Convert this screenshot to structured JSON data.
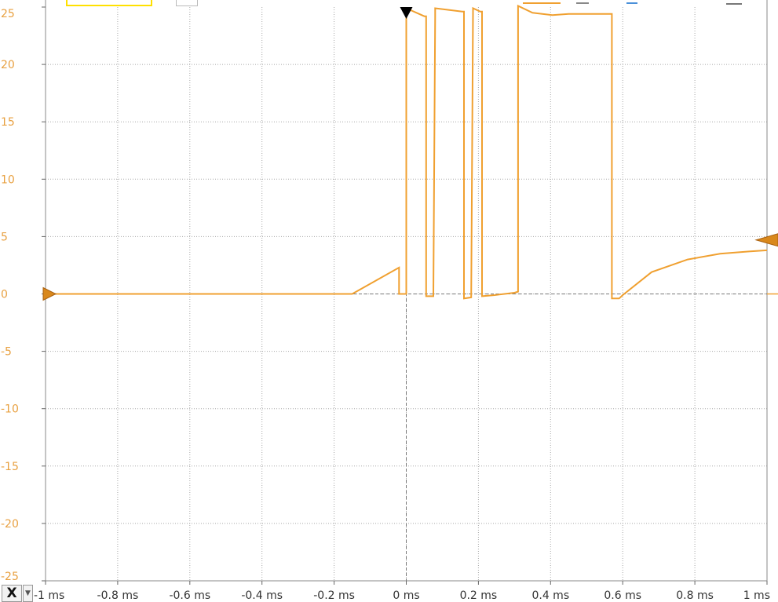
{
  "colors": {
    "trace": "#f0a030",
    "trace_dark": "#d9881c",
    "axis_label": "#e8a040",
    "grid": "#a8a8a8",
    "zero_line": "#777777",
    "trigger_marker": "#000000",
    "background": "#ffffff"
  },
  "x_axis_control": {
    "label": "X",
    "dropdown_icon": "caret-down-icon"
  },
  "toolbar_icons": [
    "channel-color-swatch-icon",
    "toolbar-button-icon",
    "cursor-icon",
    "math-icon",
    "zoom-icon",
    "settings-icon"
  ],
  "chart_data": {
    "type": "line",
    "title": "",
    "xlabel": "",
    "ylabel": "",
    "xlim": [
      -1,
      1
    ],
    "ylim": [
      -25,
      25
    ],
    "grid": true,
    "x_ticks": [
      -1,
      -0.8,
      -0.6,
      -0.4,
      -0.2,
      0,
      0.2,
      0.4,
      0.6,
      0.8,
      1
    ],
    "x_tick_labels": [
      "-1 ms",
      "-0.8 ms",
      "-0.6 ms",
      "-0.4 ms",
      "-0.2 ms",
      "0 ms",
      "0.2 ms",
      "0.4 ms",
      "0.6 ms",
      "0.8 ms",
      "1 ms"
    ],
    "y_ticks": [
      25,
      20,
      15,
      10,
      5,
      0,
      -5,
      -10,
      -15,
      -20,
      -25
    ],
    "y_tick_labels": [
      "25",
      "20",
      "15",
      "10",
      "5",
      "0",
      "-5",
      "-10",
      "-15",
      "-20",
      "-25"
    ],
    "trigger_time": 0,
    "ground_level": 0,
    "trigger_level": 4.7,
    "series": [
      {
        "x": [
          -1,
          -0.15,
          -0.02,
          -0.02,
          0,
          0,
          0.05,
          0.055,
          0.055,
          0.075,
          0.08,
          0.08,
          0.155,
          0.16,
          0.16,
          0.18,
          0.185,
          0.185,
          0.205,
          0.21,
          0.21,
          0.245,
          0.3,
          0.31,
          0.31,
          0.35,
          0.405,
          0.45,
          0.5,
          0.57,
          0.57,
          0.59,
          0.6,
          0.68,
          0.78,
          0.87,
          0.95,
          1
        ],
        "y": [
          0,
          0,
          2.3,
          0,
          0,
          24.9,
          24.2,
          24.2,
          -0.2,
          -0.2,
          24.2,
          24.9,
          24.6,
          24.6,
          -0.4,
          -0.3,
          24.5,
          24.9,
          24.6,
          24.6,
          -0.2,
          -0.1,
          0.1,
          0.2,
          25.1,
          24.5,
          24.3,
          24.4,
          24.4,
          24.4,
          -0.4,
          -0.4,
          -0.1,
          1.9,
          3.0,
          3.5,
          3.7,
          3.8
        ]
      }
    ]
  }
}
